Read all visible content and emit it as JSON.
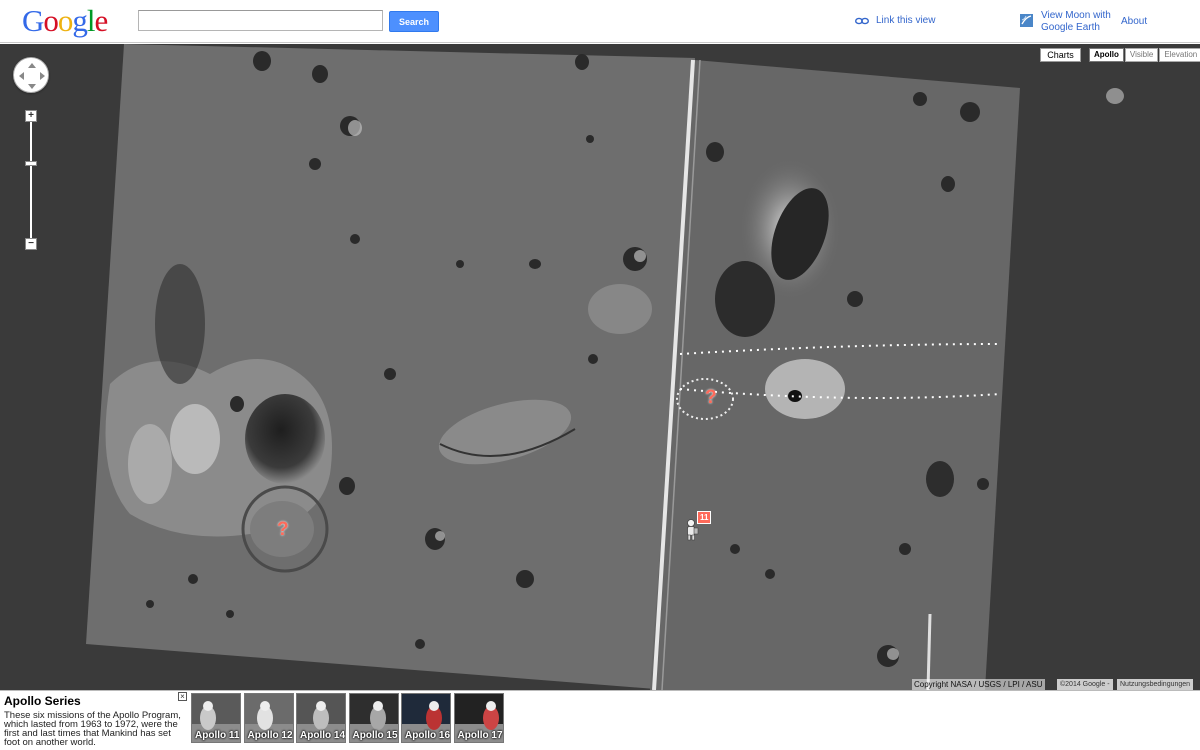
{
  "header": {
    "logo_letters": [
      {
        "ch": "G",
        "color": "#3369e8"
      },
      {
        "ch": "o",
        "color": "#d50f25"
      },
      {
        "ch": "o",
        "color": "#eeb211"
      },
      {
        "ch": "g",
        "color": "#3369e8"
      },
      {
        "ch": "l",
        "color": "#009925"
      },
      {
        "ch": "e",
        "color": "#d50f25"
      }
    ],
    "search_value": "",
    "search_button": "Search",
    "link_view": "Link this view",
    "link_view_icon": "link-icon",
    "earth_link": "View Moon with Google Earth",
    "earth_icon": "google-earth-icon",
    "about": "About"
  },
  "map": {
    "charts_label": "Charts",
    "map_types": [
      {
        "label": "Apollo",
        "active": true
      },
      {
        "label": "Visible",
        "active": false
      },
      {
        "label": "Elevation",
        "active": false
      }
    ],
    "zoom_in": "+",
    "zoom_out": "−",
    "unknown_marker": "?",
    "mission_marker": "11",
    "copyright": "Copyright NASA / USGS / LPI / ASU",
    "year_badge": "©2014 Google -",
    "terms": "Nutzungsbedingungen"
  },
  "series": {
    "title": "Apollo Series",
    "description": "These six missions of the Apollo Program, which lasted from 1963 to 1972, were the first and last times that Mankind has set foot on another world.",
    "close": "×",
    "missions": [
      {
        "label": "Apollo 11",
        "tone": "#5a5a5a",
        "accent": "#c9c9c9"
      },
      {
        "label": "Apollo 12",
        "tone": "#6b6b6b",
        "accent": "#e2e2e2"
      },
      {
        "label": "Apollo 14",
        "tone": "#555555",
        "accent": "#bdbdbd"
      },
      {
        "label": "Apollo 15",
        "tone": "#2e2e2e",
        "accent": "#a7a7a7"
      },
      {
        "label": "Apollo 16",
        "tone": "#1f2a3a",
        "accent": "#b33"
      },
      {
        "label": "Apollo 17",
        "tone": "#222222",
        "accent": "#c44"
      }
    ]
  }
}
